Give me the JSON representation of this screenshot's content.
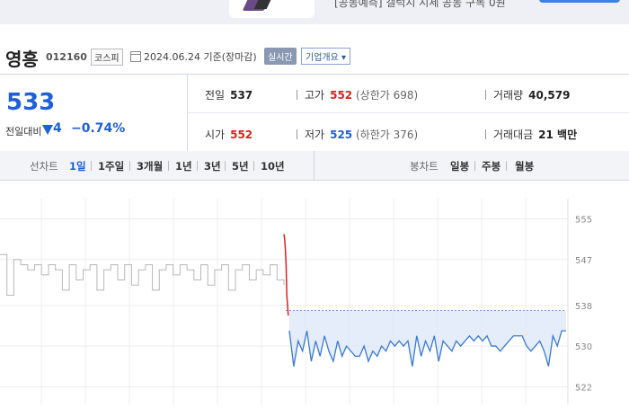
{
  "banner": {
    "text": "[공동예측] 갤럭시 시세 공동 구독 0원"
  },
  "stock": {
    "name": "영흥",
    "code": "012160",
    "market": "코스피",
    "base_date": "2024.06.24 기준(장마감)",
    "realtime_label": "실시간",
    "overview_label": "기업개요 ▾"
  },
  "price": {
    "current": "533",
    "change_label": "전일대비",
    "change": "4",
    "change_pct": "−0.74%",
    "prev_close_label": "전일",
    "prev_close": "537",
    "open_label": "시가",
    "open": "552",
    "high_label": "고가",
    "high": "552",
    "upper_limit": "(상한가 698)",
    "low_label": "저가",
    "low": "525",
    "lower_limit": "(하한가 376)",
    "volume_label": "거래량",
    "volume": "40,579",
    "amount_label": "거래대금",
    "amount": "21 백만"
  },
  "tabs": {
    "line_label": "선차트",
    "line_items": [
      "1일",
      "1주일",
      "3개월",
      "1년",
      "3년",
      "5년",
      "10년"
    ],
    "active": "1일",
    "candle_label": "봉차트",
    "candle_items": [
      "일봉",
      "주봉",
      "월봉"
    ]
  },
  "colors": {
    "up": "#e02020",
    "down": "#1f5fd8",
    "line": "#3a78d6",
    "prev_line": "#b8b8b8",
    "fill": "#dde9f7"
  },
  "chart_data": {
    "type": "line",
    "y_ticks": [
      "555",
      "547",
      "538",
      "530",
      "522"
    ],
    "ylim": [
      521,
      556
    ],
    "prev_close": 537,
    "previous_day": [
      548,
      540,
      547,
      546,
      545,
      546,
      544,
      546,
      545,
      541,
      546,
      543,
      545,
      546,
      541,
      545,
      546,
      543,
      546,
      542,
      545,
      546,
      541,
      545,
      546,
      544,
      546,
      545,
      543,
      546,
      542,
      545,
      546,
      541,
      545,
      546,
      543,
      545,
      544,
      546,
      543,
      542
    ],
    "opening_spike": [
      552,
      551,
      549,
      546,
      540,
      538,
      536
    ],
    "today": [
      533,
      526,
      531,
      529,
      533,
      527,
      531,
      528,
      532,
      529,
      527,
      531,
      528,
      530,
      529,
      528,
      528,
      530,
      527,
      529,
      528,
      530,
      529,
      531,
      530,
      531,
      530,
      531,
      526,
      532,
      528,
      531,
      529,
      532,
      527,
      531,
      530,
      529,
      531,
      530,
      531,
      532,
      531,
      532,
      531,
      532,
      530,
      530,
      529,
      530,
      531,
      532,
      532,
      532,
      530,
      529,
      530,
      531,
      529,
      526,
      532,
      530,
      533,
      533
    ]
  }
}
